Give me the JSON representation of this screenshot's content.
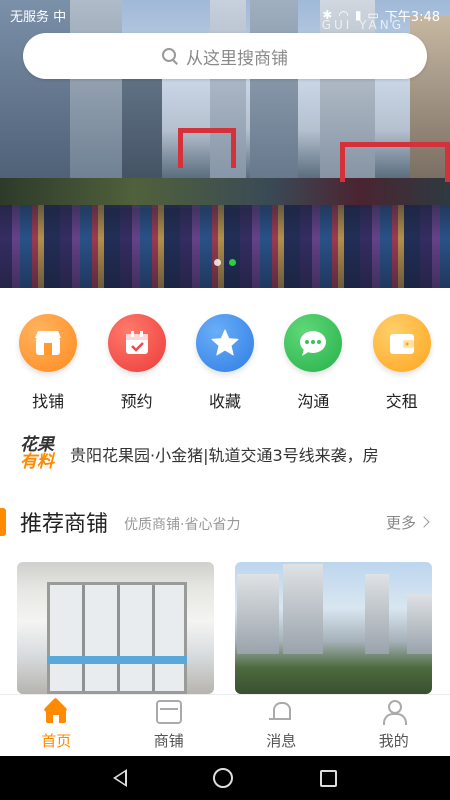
{
  "status_bar": {
    "carrier": "无服务 中",
    "time": "下午3:48"
  },
  "banner": {
    "watermark": "GUI YANG",
    "dots": 2,
    "active_dot": 1
  },
  "search": {
    "placeholder": "从这里搜商铺"
  },
  "quick_nav": [
    {
      "label": "找铺",
      "icon": "store-icon",
      "color": "#ff9a2e"
    },
    {
      "label": "预约",
      "icon": "calendar-icon",
      "color": "#f04a4a"
    },
    {
      "label": "收藏",
      "icon": "star-icon",
      "color": "#3d8ef0"
    },
    {
      "label": "沟通",
      "icon": "chat-icon",
      "color": "#37c25a"
    },
    {
      "label": "交租",
      "icon": "wallet-icon",
      "color": "#ffb52e"
    }
  ],
  "news": {
    "logo_line1": "花果",
    "logo_line2": "有料",
    "text": "贵阳花果园·小金猪|轨道交通3号线来袭，房"
  },
  "recommend": {
    "title": "推荐商铺",
    "subtitle": "优质商铺·省心省力",
    "more": "更多"
  },
  "tabs": [
    {
      "label": "首页",
      "icon": "home-icon",
      "active": true
    },
    {
      "label": "商铺",
      "icon": "shop-icon",
      "active": false
    },
    {
      "label": "消息",
      "icon": "bell-icon",
      "active": false
    },
    {
      "label": "我的",
      "icon": "user-icon",
      "active": false
    }
  ],
  "colors": {
    "accent": "#ff8a00",
    "dot_active": "#2ecc40"
  }
}
